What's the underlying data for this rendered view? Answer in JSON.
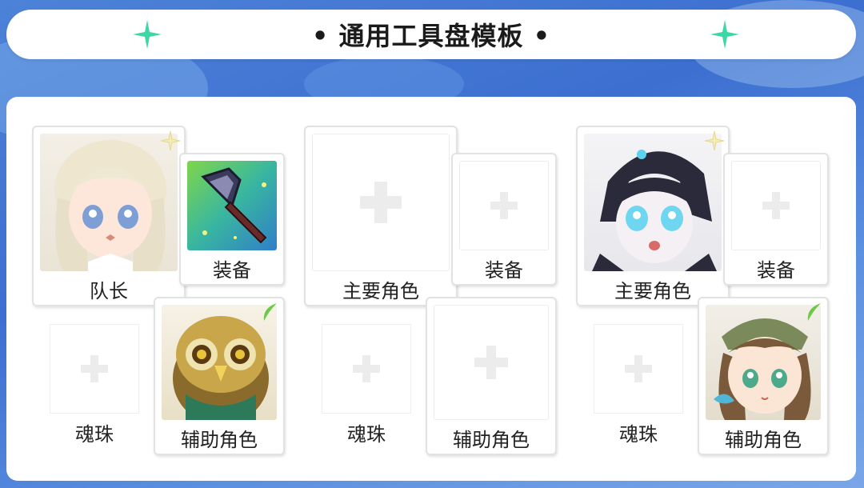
{
  "title": "• 通用工具盘模板 •",
  "groups": [
    {
      "main": {
        "label": "队长",
        "filled": true,
        "portrait": "girl-white-hair-portrait",
        "mark": "light-element-icon"
      },
      "equip": {
        "label": "装备",
        "filled": true,
        "portrait": "hammer-weapon-icon"
      },
      "soul": {
        "label": "魂珠",
        "filled": false
      },
      "support": {
        "label": "辅助角色",
        "filled": true,
        "portrait": "owl-portrait",
        "mark": "wind-element-icon"
      }
    },
    {
      "main": {
        "label": "主要角色",
        "filled": false
      },
      "equip": {
        "label": "装备",
        "filled": false
      },
      "soul": {
        "label": "魂珠",
        "filled": false
      },
      "support": {
        "label": "辅助角色",
        "filled": false
      }
    },
    {
      "main": {
        "label": "主要角色",
        "filled": true,
        "portrait": "robot-girl-portrait",
        "mark": "light-element-icon"
      },
      "equip": {
        "label": "装备",
        "filled": false
      },
      "soul": {
        "label": "魂珠",
        "filled": false
      },
      "support": {
        "label": "辅助角色",
        "filled": true,
        "portrait": "brown-hair-girl-portrait",
        "mark": "wind-element-icon"
      }
    }
  ],
  "colors": {
    "accent": "#3dd6a4",
    "background": "#3f74d4",
    "panel": "#ffffff",
    "plus": "#e8e8e8"
  }
}
